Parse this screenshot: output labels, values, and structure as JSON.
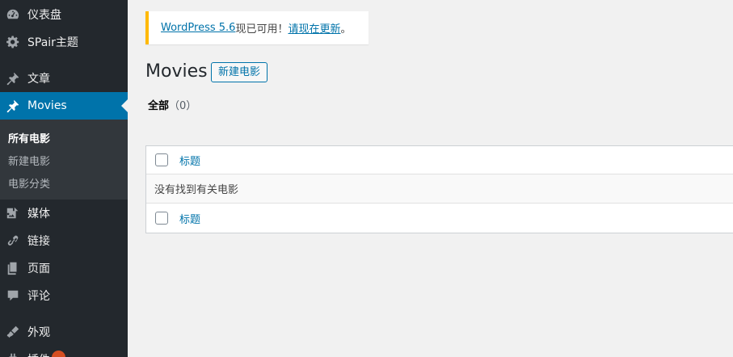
{
  "sidebar": {
    "items": [
      {
        "label": "仪表盘",
        "icon": "dashboard-icon"
      },
      {
        "label": "SPair主题",
        "icon": "gear-icon"
      },
      {
        "label": "文章",
        "icon": "pin-icon"
      },
      {
        "label": "Movies",
        "icon": "pin-icon",
        "active": true
      },
      {
        "label": "媒体",
        "icon": "media-icon"
      },
      {
        "label": "链接",
        "icon": "link-icon"
      },
      {
        "label": "页面",
        "icon": "page-icon"
      },
      {
        "label": "评论",
        "icon": "comment-icon"
      },
      {
        "label": "外观",
        "icon": "brush-icon"
      },
      {
        "label": "插件",
        "icon": "plugin-icon"
      }
    ],
    "submenu": [
      {
        "label": "所有电影",
        "current": true
      },
      {
        "label": "新建电影"
      },
      {
        "label": "电影分类"
      }
    ]
  },
  "notice": {
    "link1": "WordPress 5.6",
    "text": "现已可用！",
    "link2": "请现在更新",
    "end": "。"
  },
  "page": {
    "title": "Movies",
    "add_new": "新建电影",
    "filter_all": "全部",
    "filter_count": "（0）"
  },
  "table": {
    "column_title": "标题",
    "empty_message": "没有找到有关电影"
  },
  "colors": {
    "sidebar_bg": "#23282d",
    "submenu_bg": "#32373c",
    "accent": "#0073aa",
    "notice_border": "#ffb900",
    "badge": "#d54e21"
  }
}
